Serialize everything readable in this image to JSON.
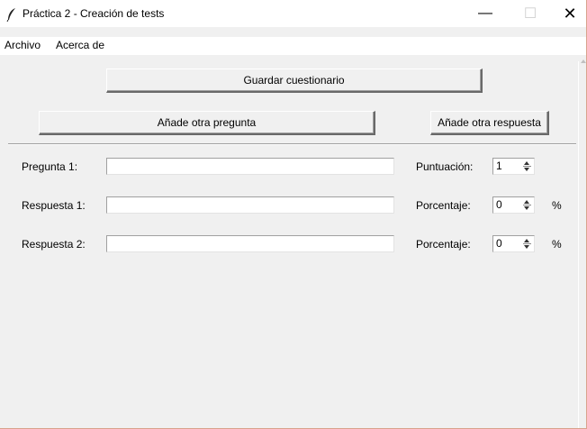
{
  "window": {
    "title": "Práctica 2 - Creación de tests",
    "minimize_glyph": "—",
    "maximize_glyph": "☐",
    "close_glyph": "✕"
  },
  "menu": {
    "items": [
      "Archivo",
      "Acerca de"
    ]
  },
  "toolbar": {
    "save_label": "Guardar cuestionario",
    "add_question_label": "Añade otra pregunta",
    "add_answer_label": "Añade otra respuesta"
  },
  "rows": [
    {
      "label": "Pregunta 1:",
      "value": "",
      "side_label": "Puntuación:",
      "spin_value": "1",
      "unit": ""
    },
    {
      "label": "Respuesta 1:",
      "value": "",
      "side_label": "Porcentaje:",
      "spin_value": "0",
      "unit": "%"
    },
    {
      "label": "Respuesta 2:",
      "value": "",
      "side_label": "Porcentaje:",
      "spin_value": "0",
      "unit": "%"
    }
  ]
}
